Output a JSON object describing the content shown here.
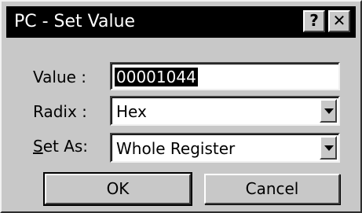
{
  "window": {
    "title": "PC - Set Value",
    "help_button": "?",
    "close_button": "✕"
  },
  "form": {
    "value_label": "Value :",
    "value": "00001044",
    "radix_label": "Radix :",
    "radix_value": "Hex",
    "setas_label_mnemonic": "S",
    "setas_label_rest": "et As:",
    "setas_value": "Whole Register"
  },
  "buttons": {
    "ok": "OK",
    "cancel": "Cancel"
  },
  "colors": {
    "titlebar": "#000000",
    "dialog_bg": "#c8c8c8",
    "selection_bg": "#000000"
  }
}
